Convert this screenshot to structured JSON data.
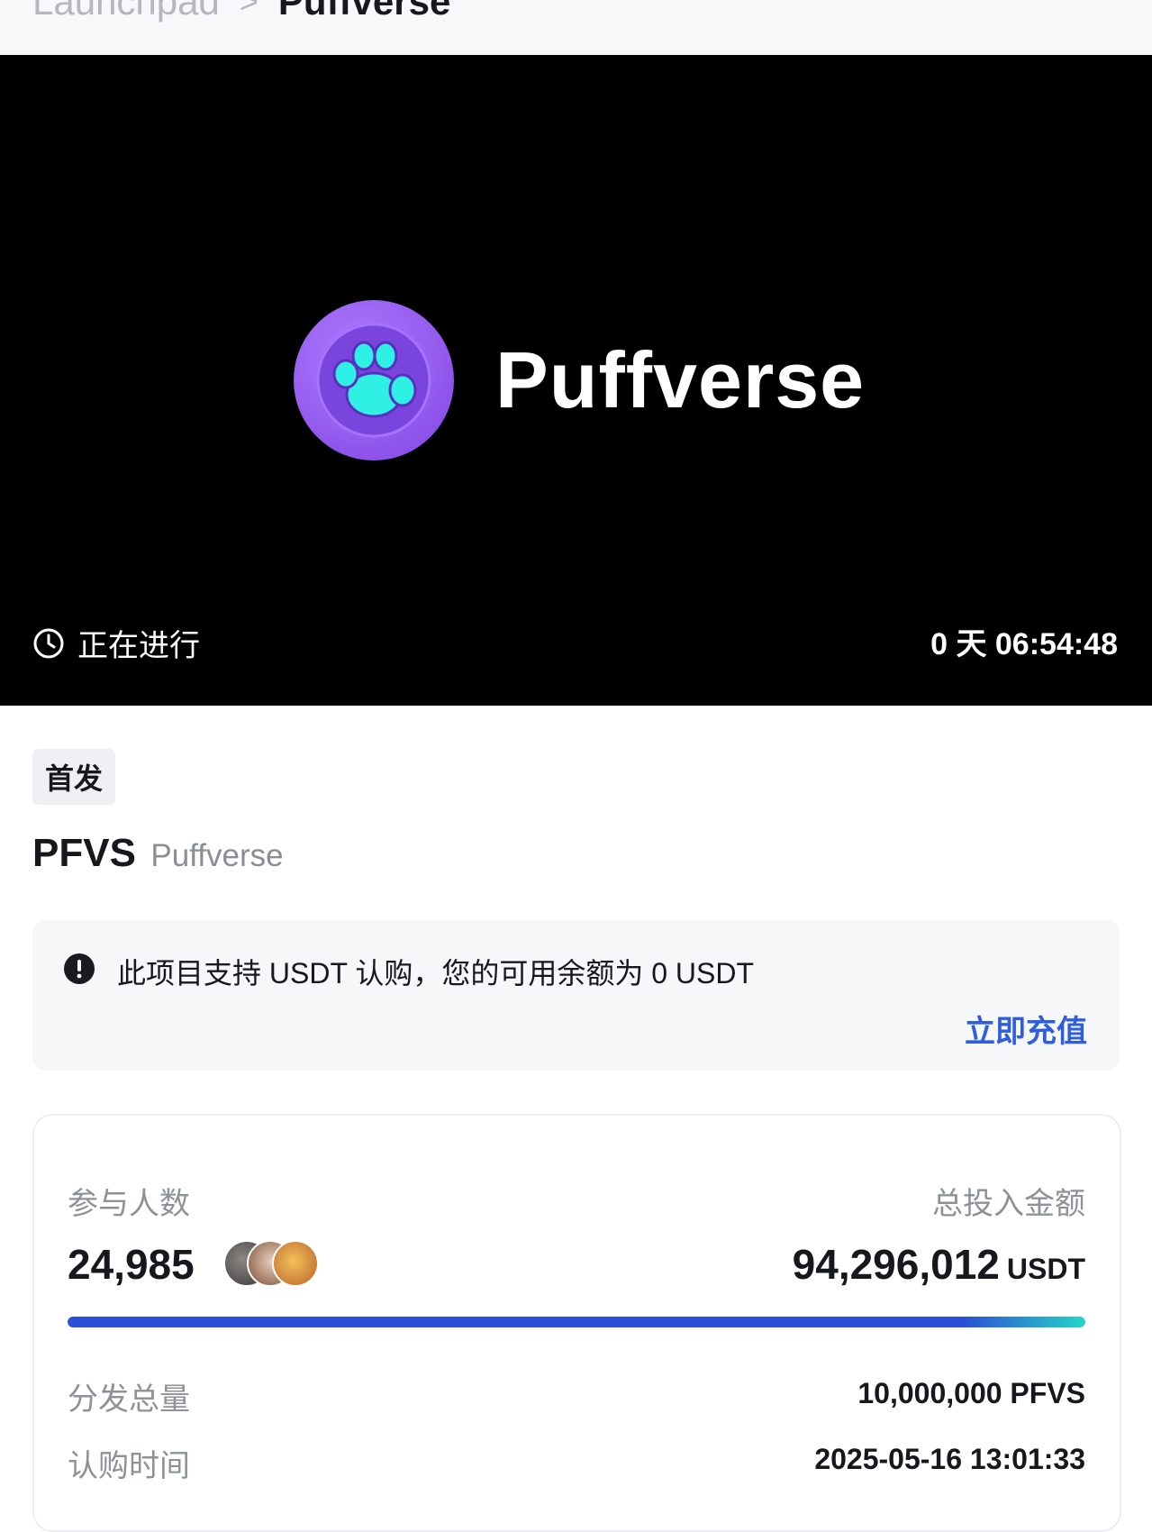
{
  "breadcrumb": {
    "parent": "Launchpad",
    "separator": ">",
    "current": "Puffverse"
  },
  "banner": {
    "logo_text": "Puffverse",
    "status_label": "正在进行",
    "countdown": "0 天 06:54:48",
    "logo_colors": {
      "outer": "#9b5cf0",
      "inner": "#7d49e0",
      "paw": "#2ff0e4"
    }
  },
  "project": {
    "tag": "首发",
    "symbol": "PFVS",
    "name": "Puffverse"
  },
  "notice": {
    "message": "此项目支持 USDT 认购，您的可用余额为 0 USDT",
    "action_label": "立即充值",
    "action_color": "#2f5ddb"
  },
  "stats": {
    "participants_label": "参与人数",
    "participants_value": "24,985",
    "total_label": "总投入金额",
    "total_value": "94,296,012",
    "total_unit": "USDT",
    "progress_fraction": 1.0,
    "distribution_label": "分发总量",
    "distribution_value": "10,000,000 PFVS",
    "subscribe_time_label": "认购时间",
    "subscribe_time_value": "2025-05-16 13:01:33"
  }
}
